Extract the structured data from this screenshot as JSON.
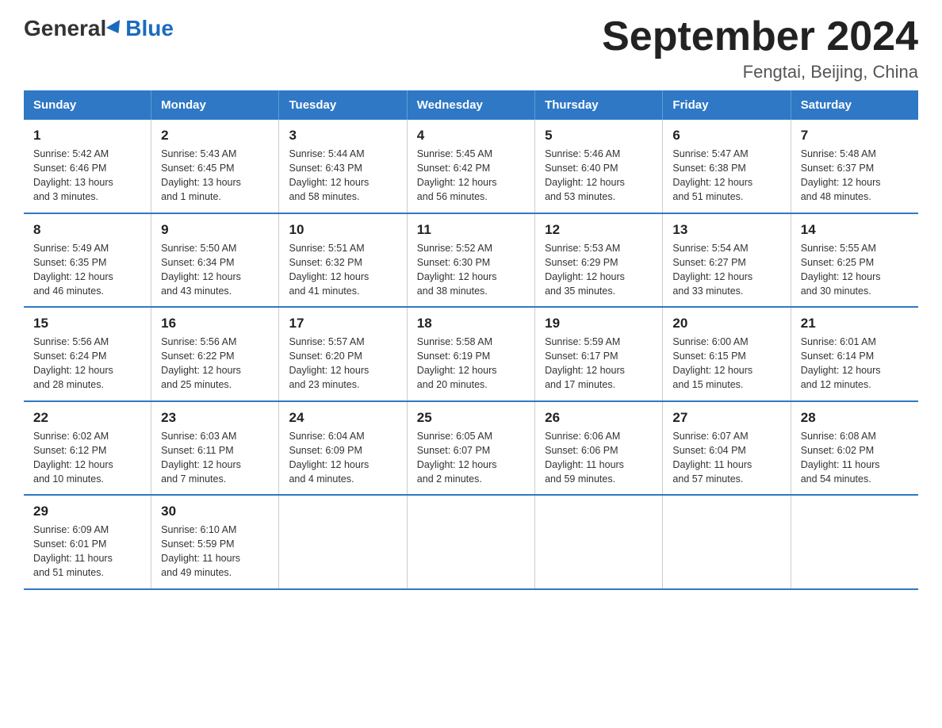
{
  "header": {
    "logo_general": "General",
    "logo_blue": "Blue",
    "month_title": "September 2024",
    "location": "Fengtai, Beijing, China"
  },
  "days_of_week": [
    "Sunday",
    "Monday",
    "Tuesday",
    "Wednesday",
    "Thursday",
    "Friday",
    "Saturday"
  ],
  "weeks": [
    [
      {
        "day": "1",
        "info": "Sunrise: 5:42 AM\nSunset: 6:46 PM\nDaylight: 13 hours\nand 3 minutes."
      },
      {
        "day": "2",
        "info": "Sunrise: 5:43 AM\nSunset: 6:45 PM\nDaylight: 13 hours\nand 1 minute."
      },
      {
        "day": "3",
        "info": "Sunrise: 5:44 AM\nSunset: 6:43 PM\nDaylight: 12 hours\nand 58 minutes."
      },
      {
        "day": "4",
        "info": "Sunrise: 5:45 AM\nSunset: 6:42 PM\nDaylight: 12 hours\nand 56 minutes."
      },
      {
        "day": "5",
        "info": "Sunrise: 5:46 AM\nSunset: 6:40 PM\nDaylight: 12 hours\nand 53 minutes."
      },
      {
        "day": "6",
        "info": "Sunrise: 5:47 AM\nSunset: 6:38 PM\nDaylight: 12 hours\nand 51 minutes."
      },
      {
        "day": "7",
        "info": "Sunrise: 5:48 AM\nSunset: 6:37 PM\nDaylight: 12 hours\nand 48 minutes."
      }
    ],
    [
      {
        "day": "8",
        "info": "Sunrise: 5:49 AM\nSunset: 6:35 PM\nDaylight: 12 hours\nand 46 minutes."
      },
      {
        "day": "9",
        "info": "Sunrise: 5:50 AM\nSunset: 6:34 PM\nDaylight: 12 hours\nand 43 minutes."
      },
      {
        "day": "10",
        "info": "Sunrise: 5:51 AM\nSunset: 6:32 PM\nDaylight: 12 hours\nand 41 minutes."
      },
      {
        "day": "11",
        "info": "Sunrise: 5:52 AM\nSunset: 6:30 PM\nDaylight: 12 hours\nand 38 minutes."
      },
      {
        "day": "12",
        "info": "Sunrise: 5:53 AM\nSunset: 6:29 PM\nDaylight: 12 hours\nand 35 minutes."
      },
      {
        "day": "13",
        "info": "Sunrise: 5:54 AM\nSunset: 6:27 PM\nDaylight: 12 hours\nand 33 minutes."
      },
      {
        "day": "14",
        "info": "Sunrise: 5:55 AM\nSunset: 6:25 PM\nDaylight: 12 hours\nand 30 minutes."
      }
    ],
    [
      {
        "day": "15",
        "info": "Sunrise: 5:56 AM\nSunset: 6:24 PM\nDaylight: 12 hours\nand 28 minutes."
      },
      {
        "day": "16",
        "info": "Sunrise: 5:56 AM\nSunset: 6:22 PM\nDaylight: 12 hours\nand 25 minutes."
      },
      {
        "day": "17",
        "info": "Sunrise: 5:57 AM\nSunset: 6:20 PM\nDaylight: 12 hours\nand 23 minutes."
      },
      {
        "day": "18",
        "info": "Sunrise: 5:58 AM\nSunset: 6:19 PM\nDaylight: 12 hours\nand 20 minutes."
      },
      {
        "day": "19",
        "info": "Sunrise: 5:59 AM\nSunset: 6:17 PM\nDaylight: 12 hours\nand 17 minutes."
      },
      {
        "day": "20",
        "info": "Sunrise: 6:00 AM\nSunset: 6:15 PM\nDaylight: 12 hours\nand 15 minutes."
      },
      {
        "day": "21",
        "info": "Sunrise: 6:01 AM\nSunset: 6:14 PM\nDaylight: 12 hours\nand 12 minutes."
      }
    ],
    [
      {
        "day": "22",
        "info": "Sunrise: 6:02 AM\nSunset: 6:12 PM\nDaylight: 12 hours\nand 10 minutes."
      },
      {
        "day": "23",
        "info": "Sunrise: 6:03 AM\nSunset: 6:11 PM\nDaylight: 12 hours\nand 7 minutes."
      },
      {
        "day": "24",
        "info": "Sunrise: 6:04 AM\nSunset: 6:09 PM\nDaylight: 12 hours\nand 4 minutes."
      },
      {
        "day": "25",
        "info": "Sunrise: 6:05 AM\nSunset: 6:07 PM\nDaylight: 12 hours\nand 2 minutes."
      },
      {
        "day": "26",
        "info": "Sunrise: 6:06 AM\nSunset: 6:06 PM\nDaylight: 11 hours\nand 59 minutes."
      },
      {
        "day": "27",
        "info": "Sunrise: 6:07 AM\nSunset: 6:04 PM\nDaylight: 11 hours\nand 57 minutes."
      },
      {
        "day": "28",
        "info": "Sunrise: 6:08 AM\nSunset: 6:02 PM\nDaylight: 11 hours\nand 54 minutes."
      }
    ],
    [
      {
        "day": "29",
        "info": "Sunrise: 6:09 AM\nSunset: 6:01 PM\nDaylight: 11 hours\nand 51 minutes."
      },
      {
        "day": "30",
        "info": "Sunrise: 6:10 AM\nSunset: 5:59 PM\nDaylight: 11 hours\nand 49 minutes."
      },
      {
        "day": "",
        "info": ""
      },
      {
        "day": "",
        "info": ""
      },
      {
        "day": "",
        "info": ""
      },
      {
        "day": "",
        "info": ""
      },
      {
        "day": "",
        "info": ""
      }
    ]
  ]
}
